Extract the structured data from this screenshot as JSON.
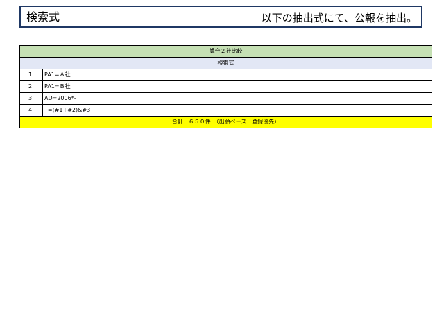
{
  "title": {
    "left": "検索式",
    "right": "以下の抽出式にて、公報を抽出。"
  },
  "table": {
    "header_main": "競合２社比較",
    "header_sub": "検索式",
    "rows": [
      {
        "num": "1",
        "expr": "PA1=Ａ社"
      },
      {
        "num": "2",
        "expr": "PA1=Ｂ社"
      },
      {
        "num": "3",
        "expr": "AD=2006*-"
      },
      {
        "num": "4",
        "expr": "T=(#1+#2)&#3"
      }
    ],
    "total": "合計　６５０件　（出願ベース　登録優先）"
  },
  "colors": {
    "title_border": "#1f3864",
    "header_main_bg": "#c5e0b4",
    "header_sub_bg": "#e2e7f5",
    "total_bg": "#ffff00"
  }
}
